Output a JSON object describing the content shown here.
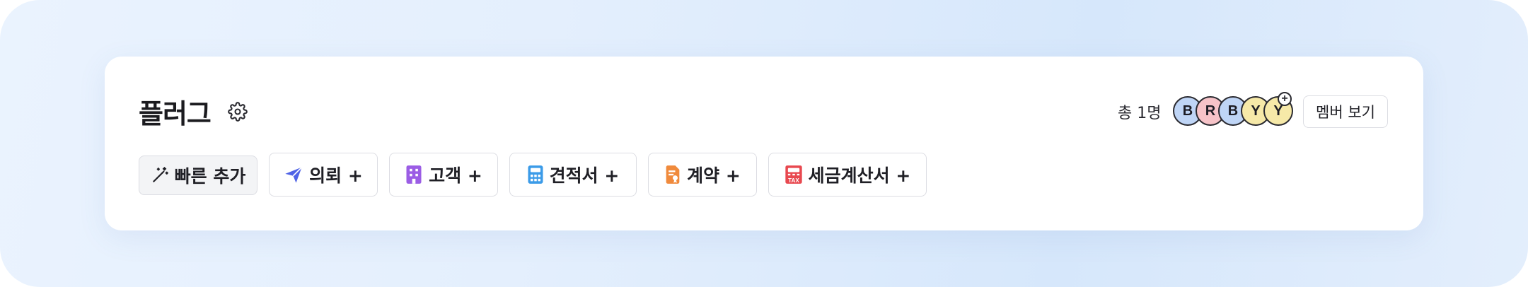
{
  "workspace": {
    "title": "플러그"
  },
  "members": {
    "total_label": "총 1명",
    "avatars": [
      {
        "letter": "B",
        "color": "#bfd5f6"
      },
      {
        "letter": "R",
        "color": "#f6c3c8"
      },
      {
        "letter": "B",
        "color": "#bfd5f6"
      },
      {
        "letter": "Y",
        "color": "#f6e9a8"
      },
      {
        "letter": "Y",
        "color": "#f6e9a8"
      }
    ],
    "add_symbol": "+",
    "view_button": "멤버 보기"
  },
  "actions": [
    {
      "label": "빠른 추가",
      "icon": "magic-wand-icon"
    },
    {
      "label": "의뢰 +",
      "icon": "paper-plane-icon",
      "color": "#4f63e6"
    },
    {
      "label": "고객 +",
      "icon": "building-icon",
      "color": "#9b5de5"
    },
    {
      "label": "견적서 +",
      "icon": "calculator-icon",
      "color": "#3b9be8"
    },
    {
      "label": "계약 +",
      "icon": "contract-icon",
      "color": "#f08a3c"
    },
    {
      "label": "세금계산서 +",
      "icon": "tax-invoice-icon",
      "color": "#e8484f",
      "icon_text": "TAX"
    }
  ]
}
